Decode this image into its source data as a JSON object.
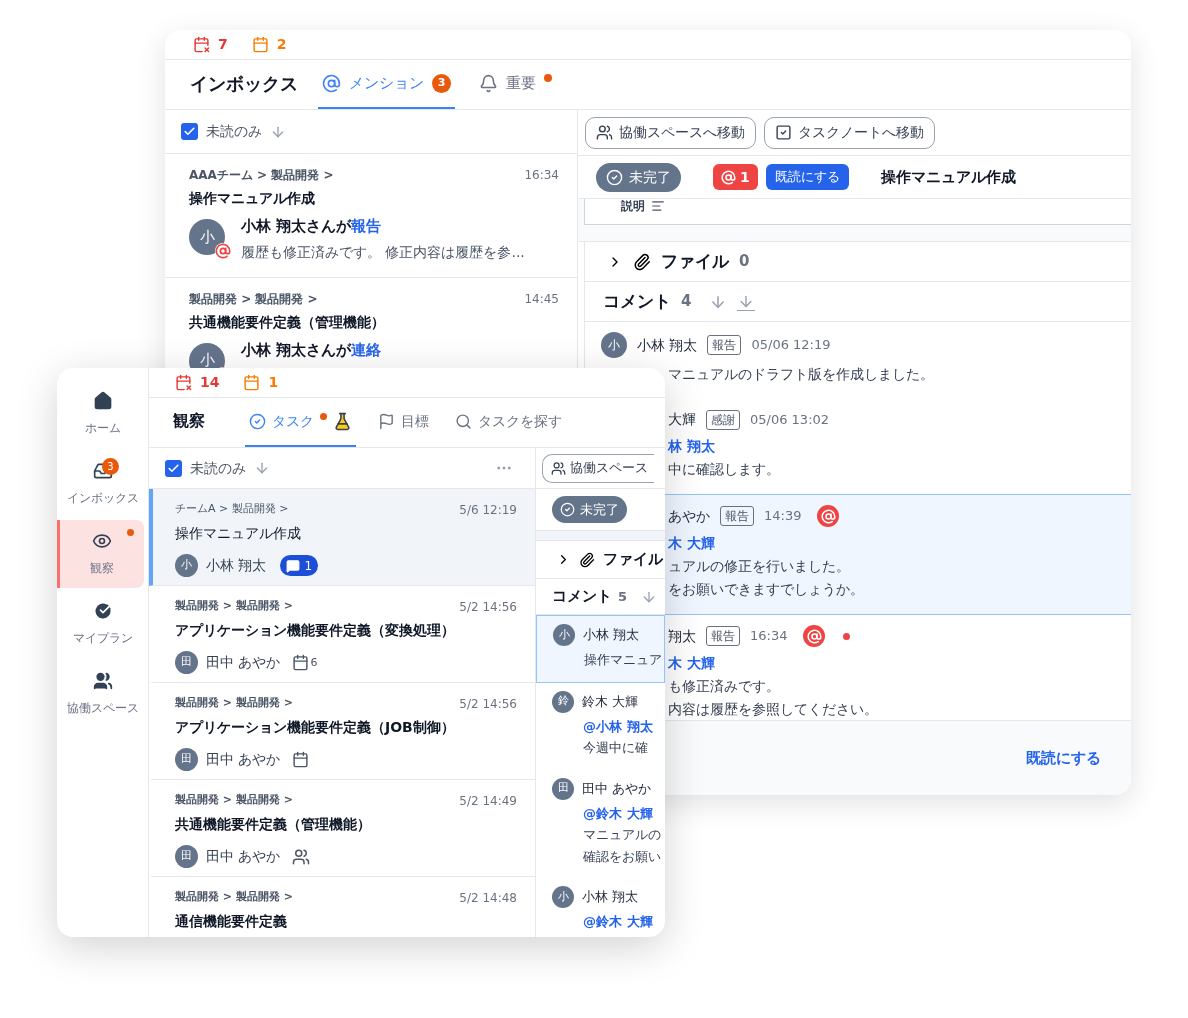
{
  "back_window": {
    "counters": [
      {
        "kind": "overdue",
        "count": "7"
      },
      {
        "kind": "due",
        "count": "2"
      }
    ],
    "title": "インボックス",
    "tabs": [
      {
        "kind": "mention",
        "label": "メンション",
        "badge": "3",
        "selected": true,
        "dot": false
      },
      {
        "kind": "important",
        "label": "重要",
        "selected": false,
        "dot": true
      }
    ],
    "filter": {
      "label": "未読のみ",
      "checked": true
    },
    "items": [
      {
        "path": "AAAチーム > 製品開発 >",
        "time": "16:34",
        "title": "操作マニュアル作成",
        "initial": "小",
        "actor": "小林 翔太さんが",
        "action": "報告",
        "preview": "履歴も修正済みです。 修正内容は履歴を参..."
      },
      {
        "path": "製品開発 > 製品開発 >",
        "time": "14:45",
        "title": "共通機能要件定義（管理機能）",
        "initial": "小",
        "actor": "小林 翔太さんが",
        "action": "連絡"
      }
    ],
    "actions": [
      {
        "kind": "space",
        "label": "協働スペースへ移動"
      },
      {
        "kind": "note",
        "label": "タスクノートへ移動"
      }
    ],
    "status": "未完了",
    "mention_count": "1",
    "mark_read": "既読にする",
    "task_title": "操作マニュアル作成",
    "description_label": "説明",
    "files": {
      "label": "ファイル",
      "count": "0",
      "expanded": false
    },
    "comments_label": "コメント",
    "comments_count": "4",
    "comments": [
      {
        "initial": "小",
        "name": "小林 翔太",
        "tag": "報告",
        "time": "05/06 12:19",
        "mentioned": false,
        "unread": false,
        "selected": false,
        "lines": [
          "マニュアルのドラフト版を作成しました。"
        ]
      },
      {
        "name": "大輝",
        "tag": "感謝",
        "time": "05/06 13:02",
        "mentioned": false,
        "unread": false,
        "selected": false,
        "mention": "林 翔太",
        "lines": [
          "中に確認します。"
        ]
      },
      {
        "name": "あやか",
        "tag": "報告",
        "time": "14:39",
        "mentioned": true,
        "unread": false,
        "selected": true,
        "mention": "木 大輝",
        "lines": [
          "ュアルの修正を行いました。",
          "をお願いできますでしょうか。"
        ]
      },
      {
        "name": "翔太",
        "tag": "報告",
        "time": "16:34",
        "mentioned": true,
        "unread": true,
        "selected": false,
        "mention": "木 大輝",
        "lines": [
          "も修正済みです。",
          "内容は履歴を参照してください。"
        ]
      }
    ],
    "footer_action": "既読にする"
  },
  "front_window": {
    "sidebar": [
      {
        "kind": "home",
        "label": "ホーム",
        "selected": false,
        "dot": false
      },
      {
        "kind": "inbox",
        "label": "インボックス",
        "badge": "3",
        "selected": false,
        "dot": false
      },
      {
        "kind": "watch",
        "label": "観察",
        "selected": true,
        "dot": true
      },
      {
        "kind": "plan",
        "label": "マイプラン",
        "selected": false,
        "dot": false
      },
      {
        "kind": "space",
        "label": "協働スペース",
        "selected": false,
        "dot": false
      }
    ],
    "counters": [
      {
        "kind": "overdue",
        "count": "14"
      },
      {
        "kind": "due",
        "count": "1"
      }
    ],
    "title": "観察",
    "tabs": [
      {
        "kind": "task",
        "label": "タスク",
        "selected": true,
        "dot": true,
        "lab": true
      },
      {
        "kind": "goal",
        "label": "目標",
        "selected": false,
        "dot": false,
        "lab": false
      },
      {
        "kind": "search",
        "label": "タスクを探す",
        "selected": false,
        "dot": false,
        "lab": false
      }
    ],
    "filter": {
      "label": "未読のみ",
      "checked": true
    },
    "tasks": [
      {
        "path": "チームA > 製品開発 >",
        "time": "5/6 12:19",
        "title": "操作マニュアル作成",
        "unread": false,
        "selected": true,
        "initial": "小",
        "assignee": "小林 翔太",
        "extra": {
          "kind": "comments",
          "count": "1"
        }
      },
      {
        "path": "製品開発 > 製品開発 >",
        "time": "5/2 14:56",
        "title": "アプリケーション機能要件定義（変換処理）",
        "unread": true,
        "selected": false,
        "initial": "田",
        "assignee": "田中 あやか",
        "extra": {
          "kind": "due",
          "count": "6"
        }
      },
      {
        "path": "製品開発 > 製品開発 >",
        "time": "5/2 14:56",
        "title": "アプリケーション機能要件定義（JOB制御）",
        "unread": true,
        "selected": false,
        "initial": "田",
        "assignee": "田中 あやか",
        "extra": {
          "kind": "due"
        }
      },
      {
        "path": "製品開発 > 製品開発 >",
        "time": "5/2 14:49",
        "title": "共通機能要件定義（管理機能）",
        "unread": true,
        "selected": false,
        "initial": "田",
        "assignee": "田中 あやか",
        "extra": {
          "kind": "members"
        }
      },
      {
        "path": "製品開発 > 製品開発 >",
        "time": "5/2 14:48",
        "title": "通信機能要件定義",
        "unread": true,
        "selected": false
      }
    ],
    "action": "協働スペース",
    "status": "未完了",
    "files_label": "ファイル",
    "comments_label": "コメント",
    "comments_count": "5",
    "comments": [
      {
        "initial": "小",
        "name": "小林 翔太",
        "selected": true,
        "lines": [
          "操作マニュア"
        ]
      },
      {
        "initial": "鈴",
        "name": "鈴木 大輝",
        "selected": false,
        "mention": "@小林 翔太",
        "lines": [
          "今週中に確"
        ]
      },
      {
        "initial": "田",
        "name": "田中 あやか",
        "selected": false,
        "mention": "@鈴木 大輝",
        "lines": [
          "マニュアルの",
          "確認をお願い"
        ]
      },
      {
        "initial": "小",
        "name": "小林 翔太",
        "selected": false,
        "mention": "@鈴木 大輝"
      }
    ]
  }
}
